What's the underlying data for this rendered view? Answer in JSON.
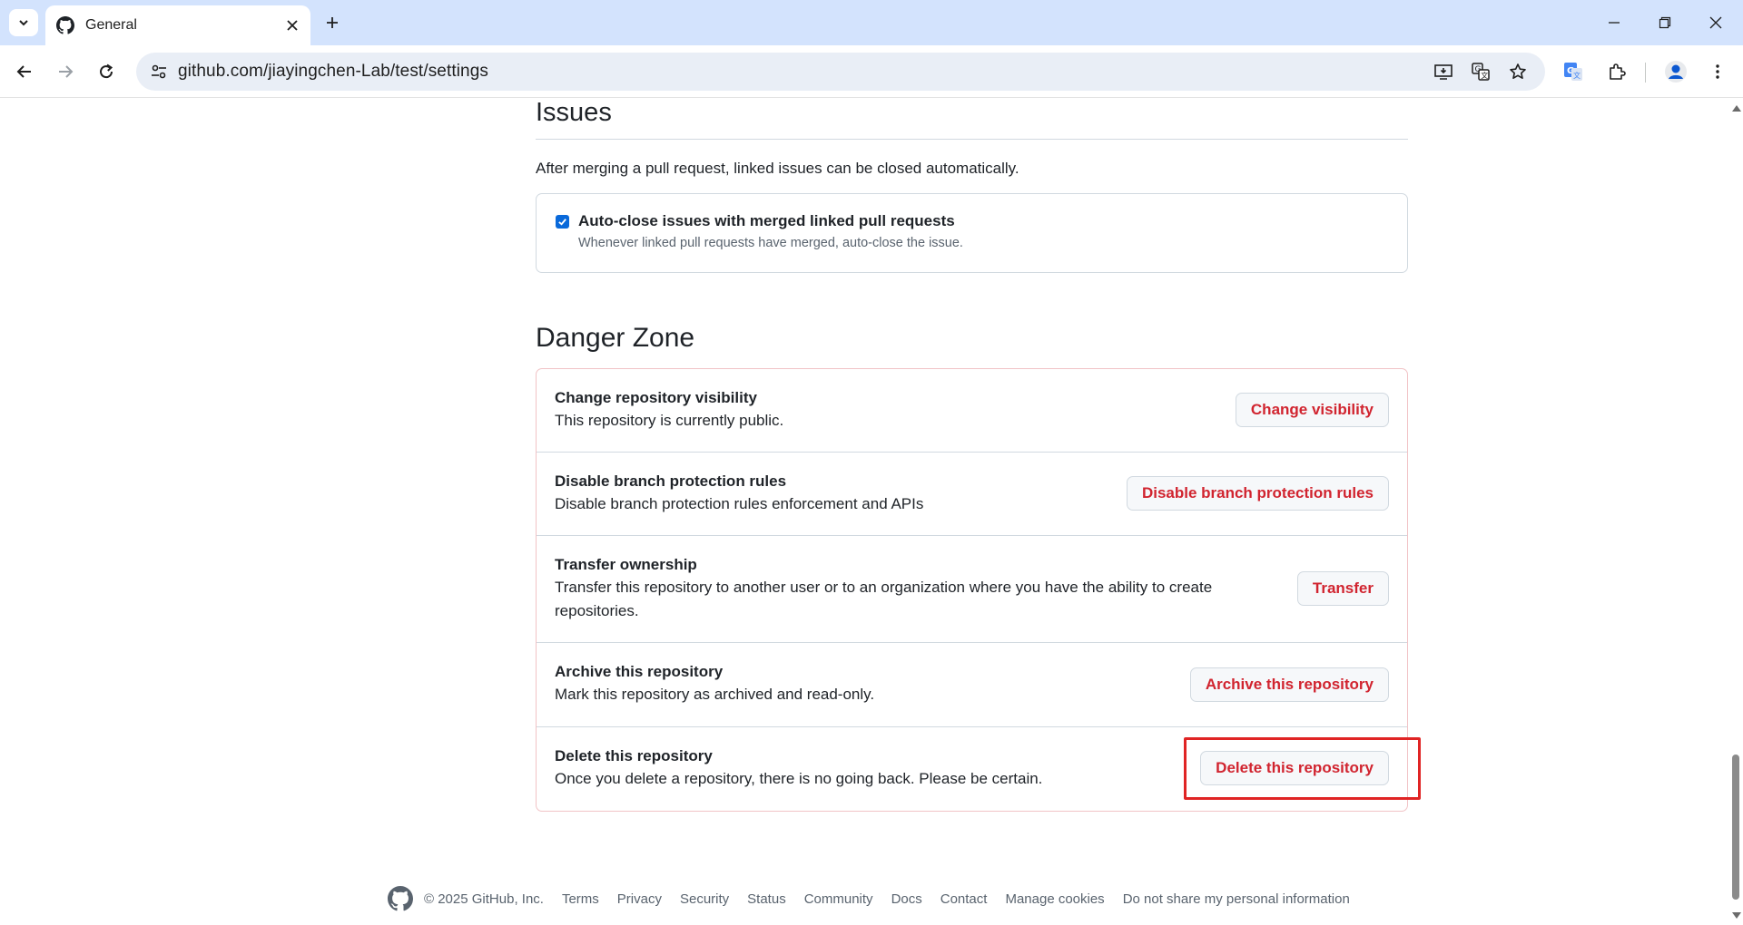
{
  "browser": {
    "tab_title": "General",
    "url": "github.com/jiayingchen-Lab/test/settings"
  },
  "issues": {
    "title": "Issues",
    "description": "After merging a pull request, linked issues can be closed automatically.",
    "auto_close": {
      "label": "Auto-close issues with merged linked pull requests",
      "note": "Whenever linked pull requests have merged, auto-close the issue.",
      "checked": true
    }
  },
  "danger_zone": {
    "title": "Danger Zone",
    "rows": [
      {
        "title": "Change repository visibility",
        "desc": "This repository is currently public.",
        "button": "Change visibility"
      },
      {
        "title": "Disable branch protection rules",
        "desc": "Disable branch protection rules enforcement and APIs",
        "button": "Disable branch protection rules"
      },
      {
        "title": "Transfer ownership",
        "desc": "Transfer this repository to another user or to an organization where you have the ability to create repositories.",
        "button": "Transfer"
      },
      {
        "title": "Archive this repository",
        "desc": "Mark this repository as archived and read-only.",
        "button": "Archive this repository"
      },
      {
        "title": "Delete this repository",
        "desc": "Once you delete a repository, there is no going back. Please be certain.",
        "button": "Delete this repository"
      }
    ]
  },
  "footer": {
    "copyright": "© 2025 GitHub, Inc.",
    "links": [
      "Terms",
      "Privacy",
      "Security",
      "Status",
      "Community",
      "Docs",
      "Contact",
      "Manage cookies",
      "Do not share my personal information"
    ]
  },
  "colors": {
    "danger": "#d1242f",
    "tabstrip": "#d3e3fd",
    "highlight": "#e02424",
    "checkbox": "#0969da"
  }
}
